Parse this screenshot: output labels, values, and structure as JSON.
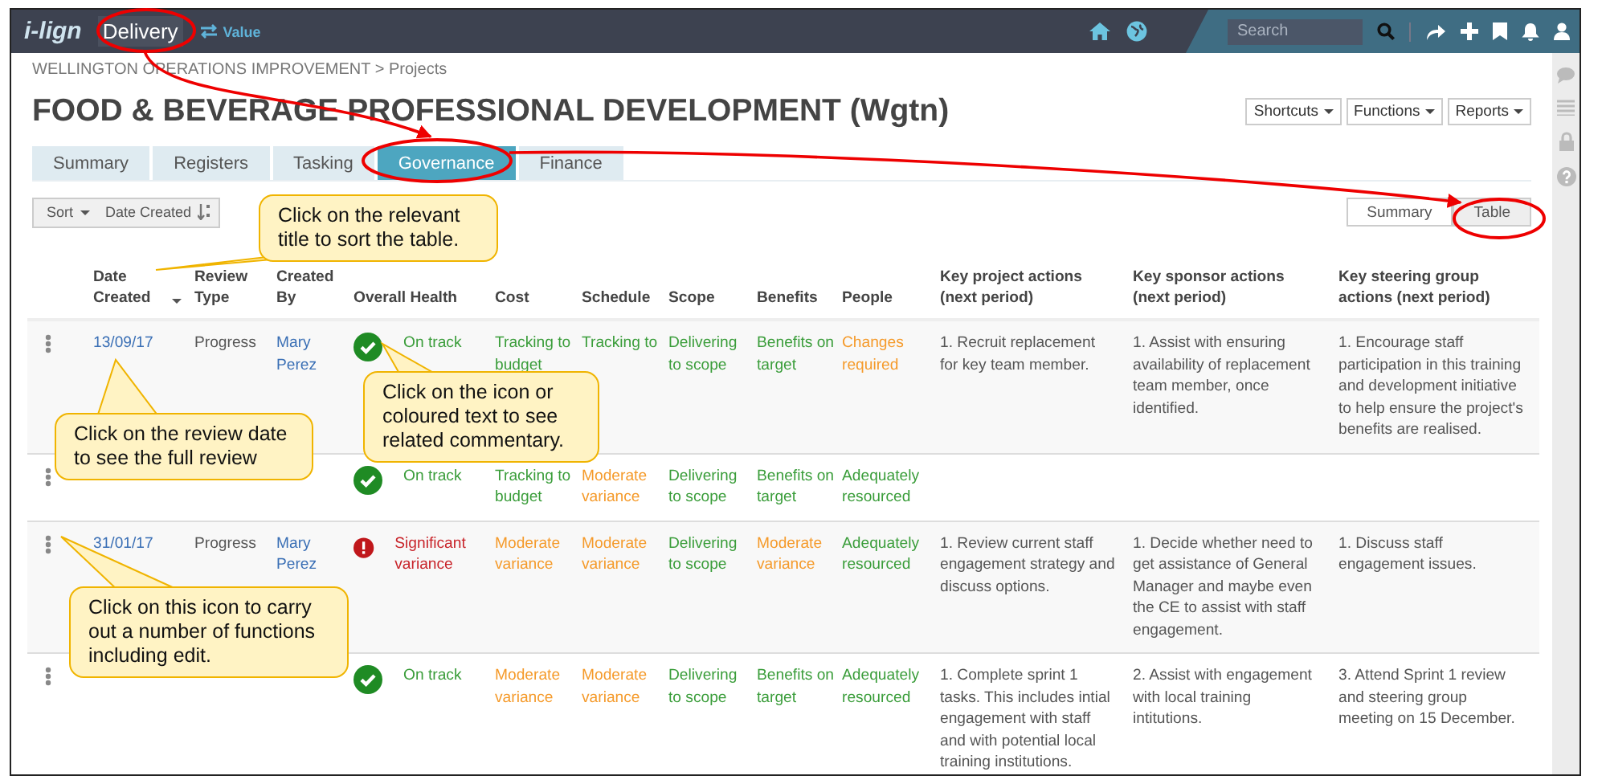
{
  "top_bar": {
    "logo": "i-lign",
    "module": "Delivery",
    "switch_label": "Value",
    "search": {
      "placeholder": "Search"
    }
  },
  "breadcrumb": "WELLINGTON OPERATIONS IMPROVEMENT > Projects",
  "title": "FOOD & BEVERAGE PROFESSIONAL DEVELOPMENT (Wgtn)",
  "header_buttons": [
    "Shortcuts",
    "Functions",
    "Reports"
  ],
  "tabs": [
    {
      "label": "Summary",
      "selected": false
    },
    {
      "label": "Registers",
      "selected": false
    },
    {
      "label": "Tasking",
      "selected": false
    },
    {
      "label": "Governance",
      "selected": true
    },
    {
      "label": "Finance",
      "selected": false
    }
  ],
  "sort": {
    "label": "Sort",
    "field": "Date Created"
  },
  "views": [
    {
      "label": "Summary",
      "selected": false
    },
    {
      "label": "Table",
      "selected": true
    }
  ],
  "columns": [
    "Date Created",
    "Review Type",
    "Created By",
    "Overall Health",
    "Cost",
    "Schedule",
    "Scope",
    "Benefits",
    "People",
    "Key project actions (next period)",
    "Key sponsor actions (next period)",
    "Key steering group actions (next period)"
  ],
  "rows": [
    {
      "date": "13/09/17",
      "review_type": "Progress",
      "created_by": "Mary Perez",
      "health": {
        "kind": "check",
        "text": "On track",
        "color": "#3a9d3a"
      },
      "cost": {
        "color": "#3a9d3a",
        "text": "Tracking to budget"
      },
      "schedule": {
        "color": "#3a9d3a",
        "text": "Tracking to"
      },
      "scope": {
        "color": "#3a9d3a",
        "text": "Delivering to scope"
      },
      "benefits": {
        "color": "#3a9d3a",
        "text": "Benefits on target"
      },
      "people": {
        "color": "#f59a2a",
        "text": "Changes required"
      },
      "project_actions": "1. Recruit replacement for key team member.",
      "sponsor_actions": "1. Assist with ensuring availability of replacement team member, once identified.",
      "steering_actions": "1. Encourage staff participation in this training and development initiative to help ensure the project's benefits are realised."
    },
    {
      "health": {
        "kind": "check",
        "text": "On track",
        "color": "#3a9d3a"
      },
      "cost": {
        "color": "#3a9d3a",
        "text": "Tracking to budget"
      },
      "schedule": {
        "color": "#f59a2a",
        "text": "Moderate variance"
      },
      "scope": {
        "color": "#3a9d3a",
        "text": "Delivering to scope"
      },
      "benefits": {
        "color": "#3a9d3a",
        "text": "Benefits on target"
      },
      "people": {
        "color": "#3a9d3a",
        "text": "Adequately resourced"
      }
    },
    {
      "date": "31/01/17",
      "review_type": "Progress",
      "created_by": "Mary Perez",
      "health": {
        "kind": "alert",
        "text": "Significant variance",
        "color": "#c8242a"
      },
      "cost": {
        "color": "#f59a2a",
        "text": "Moderate variance"
      },
      "schedule": {
        "color": "#f59a2a",
        "text": "Moderate variance"
      },
      "scope": {
        "color": "#3a9d3a",
        "text": "Delivering to scope"
      },
      "benefits": {
        "color": "#f59a2a",
        "text": "Moderate variance"
      },
      "people": {
        "color": "#3a9d3a",
        "text": "Adequately resourced"
      },
      "project_actions": "1. Review current staff engagement strategy and discuss options.",
      "sponsor_actions": "1. Decide whether need to get assistance of General Manager and maybe even the CE to assist with staff engagement.",
      "steering_actions": "1. Discuss staff engagement issues."
    },
    {
      "health": {
        "kind": "check",
        "text": "On track",
        "color": "#3a9d3a"
      },
      "cost": {
        "color": "#f59a2a",
        "text": "Moderate variance"
      },
      "schedule": {
        "color": "#f59a2a",
        "text": "Moderate variance"
      },
      "scope": {
        "color": "#3a9d3a",
        "text": "Delivering to scope"
      },
      "benefits": {
        "color": "#3a9d3a",
        "text": "Benefits on target"
      },
      "people": {
        "color": "#3a9d3a",
        "text": "Adequately resourced"
      },
      "project_actions": "1. Complete sprint 1 tasks. This includes intial engagement with staff and with potential local training institutions.",
      "sponsor_actions": "2. Assist with engagement with local training intitutions.",
      "steering_actions": "3. Attend Sprint 1 review and steering group meeting on 15 December."
    }
  ],
  "callouts": [
    {
      "text": "Click on the relevant title to sort the table."
    },
    {
      "text": "Click on the review date to see the full review"
    },
    {
      "text": "Click on the icon or coloured text to see related commentary."
    },
    {
      "text": "Click on this icon to carry out a number of functions including edit."
    }
  ]
}
